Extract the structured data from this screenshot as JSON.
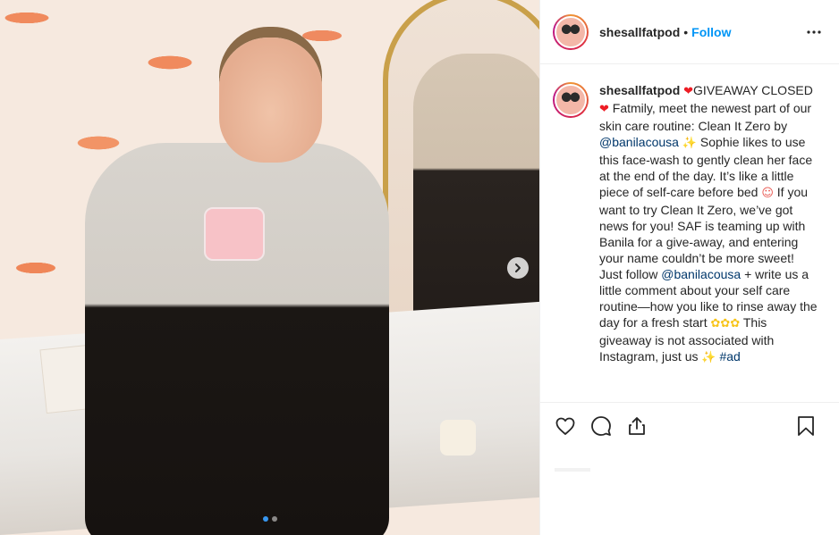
{
  "post": {
    "username": "shesallfatpod",
    "follow_label": "Follow",
    "separator": "•",
    "caption": {
      "username": "shesallfatpod",
      "p1_giveaway": "GIVEAWAY CLOSED",
      "p1_text": "Fatmily, meet the newest part of our skin care routine: Clean It Zero by",
      "mention_1": "@banilacousa",
      "p2_text": "Sophie likes to use this face-wash to gently clean her face at the end of the day. It’s like a little piece of self-care before bed",
      "p3_text": "If you want to try Clean It Zero, we’ve got news for you! SAF is teaming up with Banila for a give-away, and entering your name couldn’t be more sweet! Just follow",
      "mention_2": "@banilacousa",
      "p4_text": "+ write us a little comment about your self care routine—how you like to rinse away the day for a fresh start",
      "p5_text": "This giveaway is not associated with Instagram, just us",
      "hashtag": "#ad"
    },
    "emoji": {
      "heart": "❤",
      "sparkle": "✨",
      "blush": "☺",
      "flower": "✿"
    },
    "carousel": {
      "slides": 2,
      "active": 1
    }
  },
  "icons": [
    "more-options-icon",
    "heart-icon",
    "comment-icon",
    "share-icon",
    "bookmark-icon",
    "chevron-right-icon"
  ],
  "colors": {
    "link": "#0095f6",
    "mention": "#00376b",
    "text": "#262626",
    "border": "#efefef",
    "dot_active": "#3897f0"
  }
}
